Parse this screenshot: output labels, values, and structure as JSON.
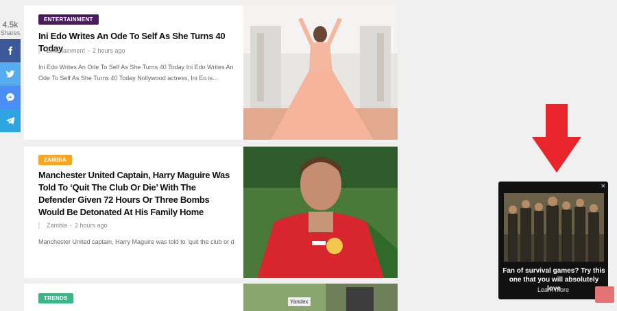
{
  "share": {
    "count": "4.5k",
    "label": "Shares",
    "buttons": [
      {
        "icon": "facebook-icon"
      },
      {
        "icon": "twitter-icon"
      },
      {
        "icon": "messenger-icon"
      },
      {
        "icon": "telegram-icon"
      }
    ]
  },
  "articles": [
    {
      "category": "ENTERTAINMENT",
      "category_color": "#4a1a5e",
      "title": "Ini Edo Writes An Ode To Self As She Turns 40 Today",
      "meta_category": "Entertainment",
      "time": "2 hours ago",
      "excerpt": "Ini Edo Writes An Ode To Self As She Turns 40 Today Ini Edo Writes An Ode To Self As She Turns 40 Today   Nollywood actress, Ini Eo is..."
    },
    {
      "category": "ZAMBIA",
      "category_color": "#f5a623",
      "title": "Manchester United Captain, Harry Maguire Was Told To ‘Quit The Club Or Die’ With The Defender Given 72 Hours Or Three Bombs Would Be Detonated At His Family Home",
      "meta_category": "Zambia",
      "time": "2 hours ago",
      "excerpt": "Manchester United captain, Harry Maguire was told to ‘quit the club or die’"
    },
    {
      "category": "TRENDS",
      "category_color": "#3eb489"
    }
  ],
  "ad": {
    "headline": "Fan of survival games? Try this one that you will absolutely love",
    "cta": "Learn more",
    "close": "×"
  },
  "yandex": "Yandex",
  "meta_separator": "-"
}
